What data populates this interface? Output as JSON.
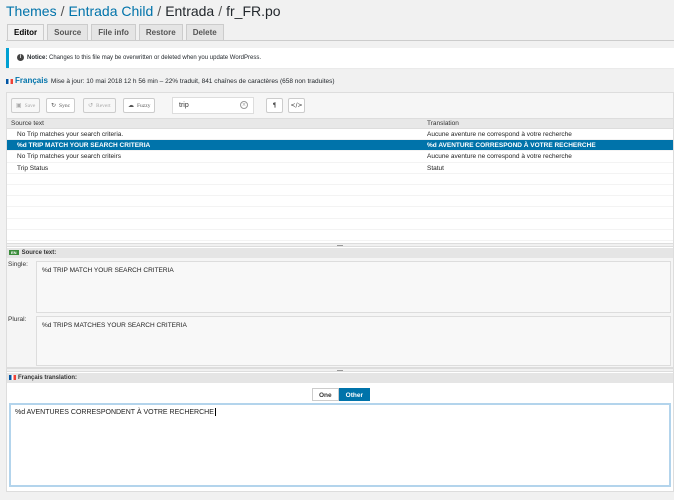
{
  "breadcrumb": {
    "themes": "Themes",
    "separator": "/",
    "child": "Entrada Child",
    "theme": "Entrada",
    "file": "fr_FR.po"
  },
  "tabs": [
    {
      "label": "Editor",
      "active": true
    },
    {
      "label": "Source",
      "active": false
    },
    {
      "label": "File info",
      "active": false
    },
    {
      "label": "Restore",
      "active": false
    },
    {
      "label": "Delete",
      "active": false
    }
  ],
  "notice": {
    "prefix": "Notice:",
    "text": " Changes to this file may be overwritten or deleted when you update WordPress."
  },
  "locale": {
    "name": "Français",
    "info": "Mise à jour: 10 mai 2018 12 h 56 min – 22% traduit, 841 chaînes de caractères (658 non traduites)"
  },
  "toolbar": {
    "save": "Save",
    "sync": "Sync",
    "revert": "Revert",
    "fuzzy": "Fuzzy",
    "search_value": "trip",
    "pilcrow": "¶",
    "code": "</>"
  },
  "grid": {
    "col_source": "Source text",
    "col_translation": "Translation",
    "rows": [
      {
        "source": "No Trip matches your search criteria.",
        "translation": "Aucune aventure ne correspond à votre recherche"
      },
      {
        "source": "%d TRIP MATCH YOUR SEARCH CRITERIA",
        "translation": "%d AVENTURE CORRESPOND À VOTRE RECHERCHE"
      },
      {
        "source": "No Trip matches your search criteirs",
        "translation": "Aucune aventure ne correspond à votre recherche"
      },
      {
        "source": "Trip Status",
        "translation": "Statut"
      }
    ]
  },
  "source_panel": {
    "heading": "Source text:",
    "badge": "EN",
    "single_label": "Single:",
    "single_text": "%d TRIP MATCH YOUR SEARCH CRITERIA",
    "plural_label": "Plural:",
    "plural_text": "%d TRIPS MATCHES YOUR SEARCH CRITERIA"
  },
  "translation_panel": {
    "heading": "Français translation:",
    "form_one": "One",
    "form_other": "Other",
    "text": "%d AVENTURES CORRESPONDENT À VOTRE RECHERCHE"
  }
}
